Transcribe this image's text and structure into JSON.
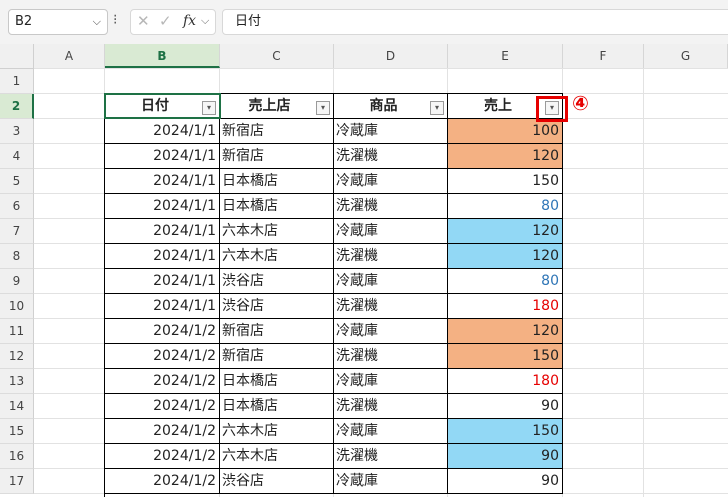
{
  "formula_bar": {
    "name_box": "B2",
    "name_box_chevron": "⌵",
    "more_icon": "⁝",
    "cancel_icon": "✕",
    "enter_icon": "✓",
    "fx_label": "fx",
    "fx_chevron": "⌵",
    "formula_value": "日付"
  },
  "columns": [
    "A",
    "B",
    "C",
    "D",
    "E",
    "F",
    "G"
  ],
  "selected_column": "B",
  "rows": [
    "1",
    "2",
    "3",
    "4",
    "5",
    "6",
    "7",
    "8",
    "9",
    "10",
    "11",
    "12",
    "13",
    "14",
    "15",
    "16",
    "17"
  ],
  "selected_row": "2",
  "table": {
    "headers": [
      "日付",
      "売上店",
      "商品",
      "売上"
    ],
    "filter_icon": "▾",
    "rows": [
      {
        "date": "2024/1/1",
        "store": "新宿店",
        "product": "冷蔵庫",
        "sales": "100"
      },
      {
        "date": "2024/1/1",
        "store": "新宿店",
        "product": "洗濯機",
        "sales": "120"
      },
      {
        "date": "2024/1/1",
        "store": "日本橋店",
        "product": "冷蔵庫",
        "sales": "150"
      },
      {
        "date": "2024/1/1",
        "store": "日本橋店",
        "product": "洗濯機",
        "sales": "80"
      },
      {
        "date": "2024/1/1",
        "store": "六本木店",
        "product": "冷蔵庫",
        "sales": "120"
      },
      {
        "date": "2024/1/1",
        "store": "六本木店",
        "product": "洗濯機",
        "sales": "120"
      },
      {
        "date": "2024/1/1",
        "store": "渋谷店",
        "product": "冷蔵庫",
        "sales": "80"
      },
      {
        "date": "2024/1/1",
        "store": "渋谷店",
        "product": "洗濯機",
        "sales": "180"
      },
      {
        "date": "2024/1/2",
        "store": "新宿店",
        "product": "冷蔵庫",
        "sales": "120"
      },
      {
        "date": "2024/1/2",
        "store": "新宿店",
        "product": "洗濯機",
        "sales": "150"
      },
      {
        "date": "2024/1/2",
        "store": "日本橋店",
        "product": "冷蔵庫",
        "sales": "180"
      },
      {
        "date": "2024/1/2",
        "store": "日本橋店",
        "product": "洗濯機",
        "sales": "90"
      },
      {
        "date": "2024/1/2",
        "store": "六本木店",
        "product": "冷蔵庫",
        "sales": "150"
      },
      {
        "date": "2024/1/2",
        "store": "六本木店",
        "product": "洗濯機",
        "sales": "90"
      },
      {
        "date": "2024/1/2",
        "store": "渋谷店",
        "product": "冷蔵庫",
        "sales": "90"
      }
    ]
  },
  "sales_styles": [
    {
      "fill": "#f4b183",
      "color": "#222222"
    },
    {
      "fill": "#f4b183",
      "color": "#222222"
    },
    {
      "fill": "#ffffff",
      "color": "#222222"
    },
    {
      "fill": "#ffffff",
      "color": "#2e75b6"
    },
    {
      "fill": "#92d8f5",
      "color": "#222222"
    },
    {
      "fill": "#92d8f5",
      "color": "#222222"
    },
    {
      "fill": "#ffffff",
      "color": "#2e75b6"
    },
    {
      "fill": "#ffffff",
      "color": "#e60000"
    },
    {
      "fill": "#f4b183",
      "color": "#222222"
    },
    {
      "fill": "#f4b183",
      "color": "#222222"
    },
    {
      "fill": "#ffffff",
      "color": "#e60000"
    },
    {
      "fill": "#ffffff",
      "color": "#222222"
    },
    {
      "fill": "#92d8f5",
      "color": "#222222"
    },
    {
      "fill": "#92d8f5",
      "color": "#222222"
    },
    {
      "fill": "#ffffff",
      "color": "#222222"
    }
  ],
  "annotation": {
    "label": "④",
    "color": "#e60000"
  },
  "colors": {
    "accent": "#1e7145",
    "selected_header_bg": "#d9ead3"
  }
}
